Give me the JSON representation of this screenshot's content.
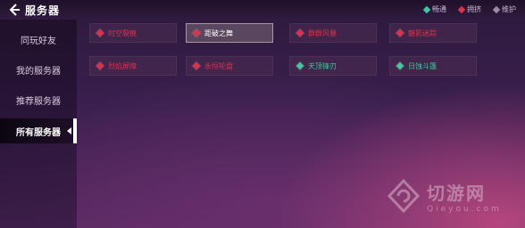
{
  "header": {
    "title": "服务器",
    "back_icon": "back-arrow-icon"
  },
  "legend": [
    {
      "label": "畅通",
      "color": "#3fc9a0"
    },
    {
      "label": "拥挤",
      "color": "#e0304a"
    },
    {
      "label": "维护",
      "color": "#9a8aa6"
    }
  ],
  "sidebar": {
    "items": [
      {
        "label": "同玩好友",
        "active": false
      },
      {
        "label": "我的服务器",
        "active": false
      },
      {
        "label": "推荐服务器",
        "active": false
      },
      {
        "label": "所有服务器",
        "active": true
      }
    ]
  },
  "servers": [
    {
      "name": "时空裂痕",
      "status": "crowded",
      "color": "#e0304a",
      "selected": false
    },
    {
      "name": "距破之舞",
      "status": "crowded",
      "color": "#e0304a",
      "selected": true
    },
    {
      "name": "群群风暴",
      "status": "crowded",
      "color": "#e0304a",
      "selected": false
    },
    {
      "name": "魅影迷踪",
      "status": "crowded",
      "color": "#e0304a",
      "selected": false
    },
    {
      "name": "烈焰屏障",
      "status": "crowded",
      "color": "#e0304a",
      "selected": false
    },
    {
      "name": "永恒轮盘",
      "status": "crowded",
      "color": "#e0304a",
      "selected": false
    },
    {
      "name": "天顶锋刃",
      "status": "smooth",
      "color": "#3fc9a0",
      "selected": false
    },
    {
      "name": "日蚀斗篷",
      "status": "smooth",
      "color": "#3fc9a0",
      "selected": false
    }
  ],
  "watermark": {
    "text": "切游网",
    "sub": "Qieyou.com"
  }
}
